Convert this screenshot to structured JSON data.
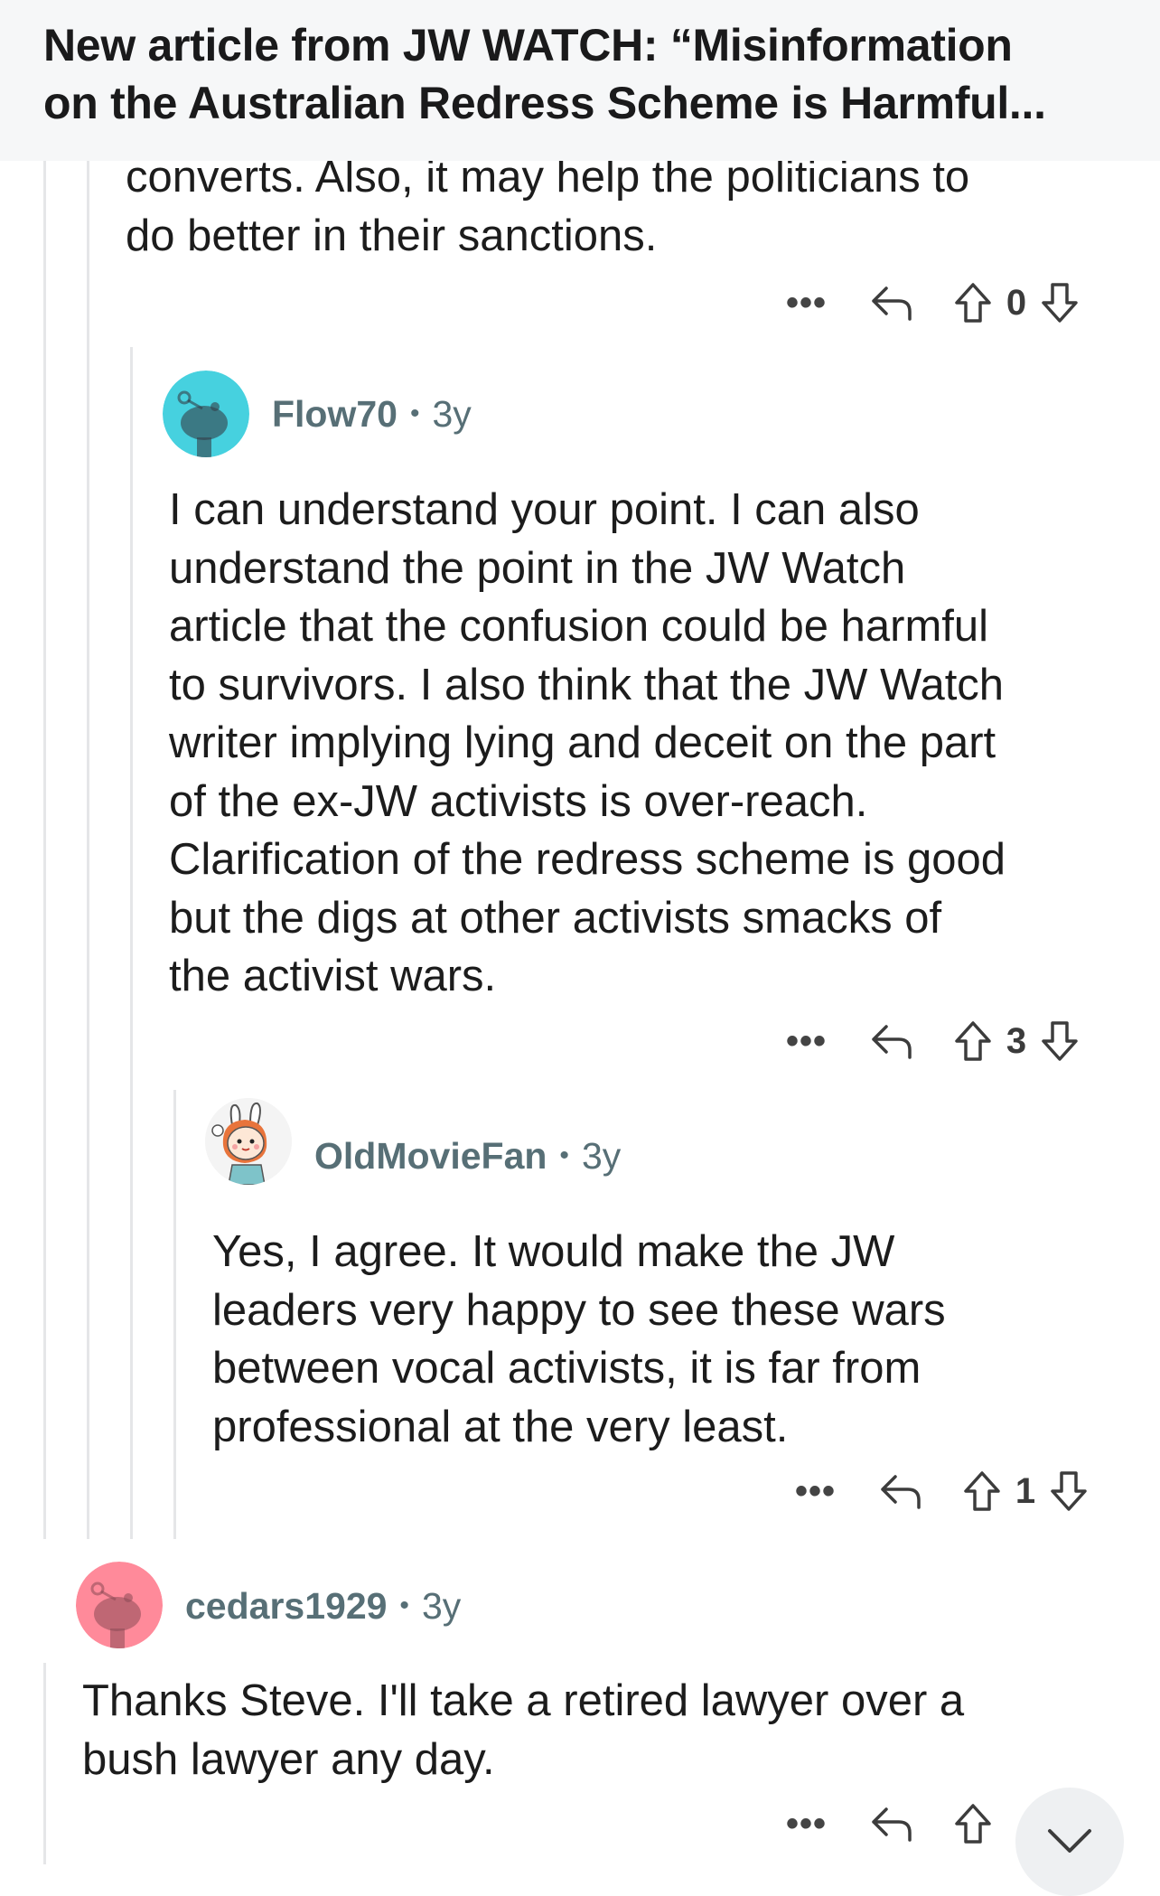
{
  "header": {
    "title_line1": "New article from JW WATCH: “Misinformation",
    "title_line2": "on the Australian Redress Scheme is Harmful..."
  },
  "comments": [
    {
      "text": "converts. Also, it may help the politicians to\ndo better in their sanctions.",
      "more_label": "•••",
      "score": "0"
    },
    {
      "user": "Flow70",
      "age": "3y",
      "avatar_color": "#46d1df",
      "text": "I can understand your point. I can also\nunderstand the point in the JW Watch\narticle that the confusion could be harmful\nto survivors. I also think that the JW Watch\nwriter implying lying and deceit on the part\nof the ex-JW activists is over-reach.\nClarification of the redress scheme is good\nbut the digs at other activists smacks of\nthe activist wars.",
      "more_label": "•••",
      "score": "3"
    },
    {
      "user": "OldMovieFan",
      "age": "3y",
      "text": "Yes, I agree.  It would make the JW\nleaders very happy to see these wars\nbetween vocal activists, it is far from\nprofessional at the very least.",
      "more_label": "•••",
      "score": "1"
    },
    {
      "user": "cedars1929",
      "age": "3y",
      "avatar_color": "#ff8a9a",
      "text": "Thanks Steve. I'll take a retired lawyer over a\nbush lawyer any day.",
      "more_label": "•••"
    }
  ],
  "meta_separator": "•",
  "icons": {
    "more": "more-icon",
    "reply": "reply-arrow-icon",
    "upvote": "upvote-arrow-icon",
    "downvote": "downvote-arrow-icon",
    "scroll": "chevron-down-icon"
  }
}
